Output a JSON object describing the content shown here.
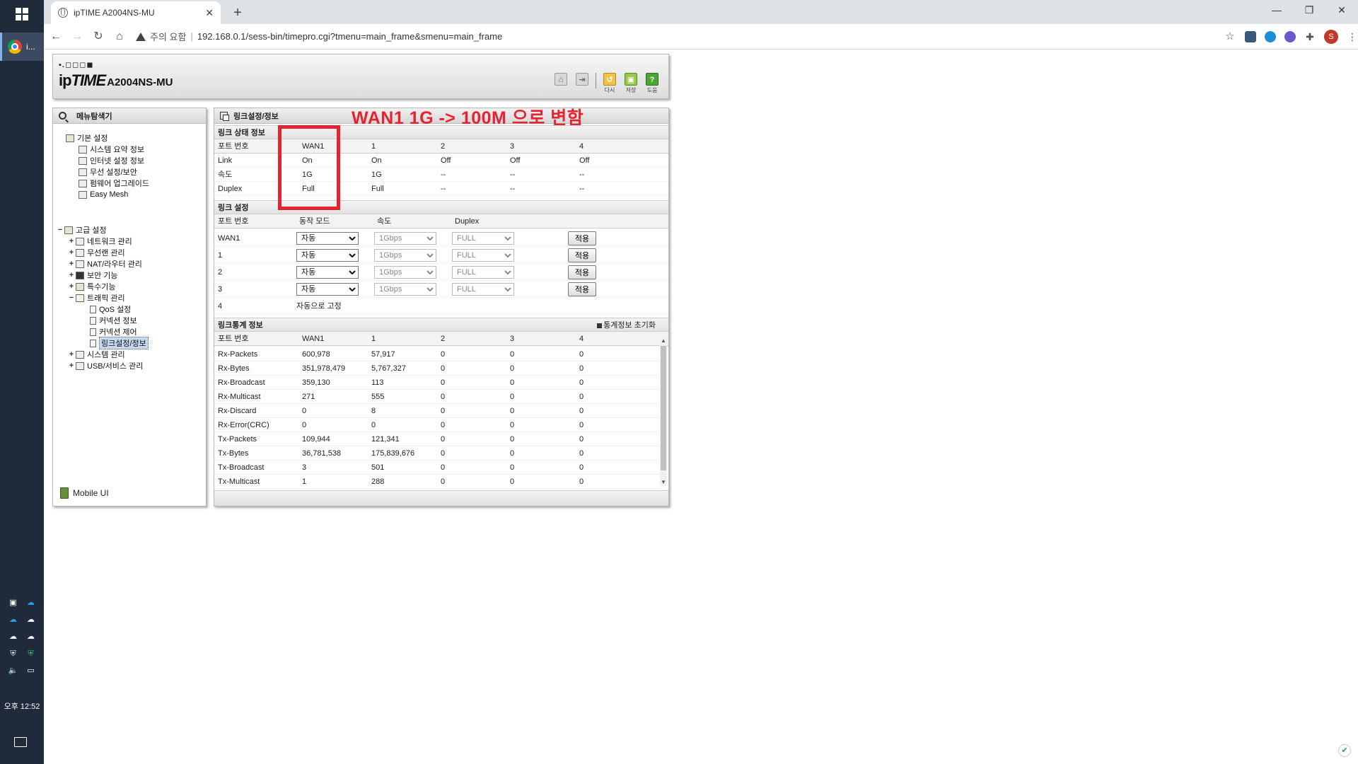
{
  "taskbar": {
    "chrome_label": "i...",
    "clock": "오후 12:52"
  },
  "browser": {
    "tab_title": "ipTIME A2004NS-MU",
    "warning_text": "주의 요함",
    "url": "192.168.0.1/sess-bin/timepro.cgi?tmenu=main_frame&smenu=main_frame",
    "profile_initial": "S"
  },
  "router": {
    "dots": "▪.◻◻◻◼",
    "logo_ip": "ip",
    "logo_time": "TIME",
    "model": "A2004NS-MU",
    "tools": [
      {
        "icon": "home-icon",
        "label": ""
      },
      {
        "icon": "logout-icon",
        "label": ""
      },
      {
        "icon": "restart-icon",
        "label": "다시"
      },
      {
        "icon": "save-icon",
        "label": "저장"
      },
      {
        "icon": "help-icon",
        "label": "도움"
      }
    ]
  },
  "menu": {
    "title": "메뉴탐색기",
    "basic_title": "기본 설정",
    "basic_items": [
      "시스템 요약 정보",
      "인터넷 설정 정보",
      "무선 설정/보안",
      "펌웨어 업그레이드",
      "Easy Mesh"
    ],
    "advanced_title": "고급 설정",
    "advanced_items": [
      {
        "label": "네트워크 관리",
        "toggle": "+"
      },
      {
        "label": "무선랜 관리",
        "toggle": "+"
      },
      {
        "label": "NAT/라우터 관리",
        "toggle": "+"
      },
      {
        "label": "보안 기능",
        "toggle": "+"
      },
      {
        "label": "특수기능",
        "toggle": "+"
      },
      {
        "label": "트래픽 관리",
        "toggle": "−"
      }
    ],
    "traffic_children": [
      "QoS 설정",
      "커넥션 정보",
      "커넥션 제어",
      "링크설정/정보"
    ],
    "after_items": [
      {
        "label": "시스템 관리",
        "toggle": "+"
      },
      {
        "label": "USB/서비스 관리",
        "toggle": "+"
      }
    ],
    "mobile_ui": "Mobile UI"
  },
  "main": {
    "title": "링크설정/정보",
    "annotation": "WAN1 1G -> 100M 으로 변함",
    "status_section": "링크 상태 정보",
    "status_header": [
      "포트 번호",
      "WAN1",
      "1",
      "2",
      "3",
      "4"
    ],
    "status_rows": [
      [
        "Link",
        "On",
        "On",
        "Off",
        "Off",
        "Off"
      ],
      [
        "속도",
        "1G",
        "1G",
        "--",
        "--",
        "--"
      ],
      [
        "Duplex",
        "Full",
        "Full",
        "--",
        "--",
        "--"
      ]
    ],
    "config_section": "링크 설정",
    "config_header": [
      "포트 번호",
      "동작 모드",
      "속도",
      "Duplex"
    ],
    "config_rows": [
      {
        "port": "WAN1",
        "mode": "자동",
        "speed": "1Gbps",
        "duplex": "FULL",
        "apply": "적용"
      },
      {
        "port": "1",
        "mode": "자동",
        "speed": "1Gbps",
        "duplex": "FULL",
        "apply": "적용"
      },
      {
        "port": "2",
        "mode": "자동",
        "speed": "1Gbps",
        "duplex": "FULL",
        "apply": "적용"
      },
      {
        "port": "3",
        "mode": "자동",
        "speed": "1Gbps",
        "duplex": "FULL",
        "apply": "적용"
      }
    ],
    "fixed_port": "4",
    "fixed_text": "자동으로 고정",
    "stats_section": "링크통계 정보",
    "stats_reset": "통계정보 초기화",
    "stats_header": [
      "포트 번호",
      "WAN1",
      "1",
      "2",
      "3",
      "4"
    ],
    "stats_rows": [
      [
        "Rx-Packets",
        "600,978",
        "57,917",
        "0",
        "0",
        "0"
      ],
      [
        "Rx-Bytes",
        "351,978,479",
        "5,767,327",
        "0",
        "0",
        "0"
      ],
      [
        "Rx-Broadcast",
        "359,130",
        "113",
        "0",
        "0",
        "0"
      ],
      [
        "Rx-Multicast",
        "271",
        "555",
        "0",
        "0",
        "0"
      ],
      [
        "Rx-Discard",
        "0",
        "8",
        "0",
        "0",
        "0"
      ],
      [
        "Rx-Error(CRC)",
        "0",
        "0",
        "0",
        "0",
        "0"
      ],
      [
        "Tx-Packets",
        "109,944",
        "121,341",
        "0",
        "0",
        "0"
      ],
      [
        "Tx-Bytes",
        "36,781,538",
        "175,839,676",
        "0",
        "0",
        "0"
      ],
      [
        "Tx-Broadcast",
        "3",
        "501",
        "0",
        "0",
        "0"
      ],
      [
        "Tx-Multicast",
        "1",
        "288",
        "0",
        "0",
        "0"
      ]
    ]
  }
}
